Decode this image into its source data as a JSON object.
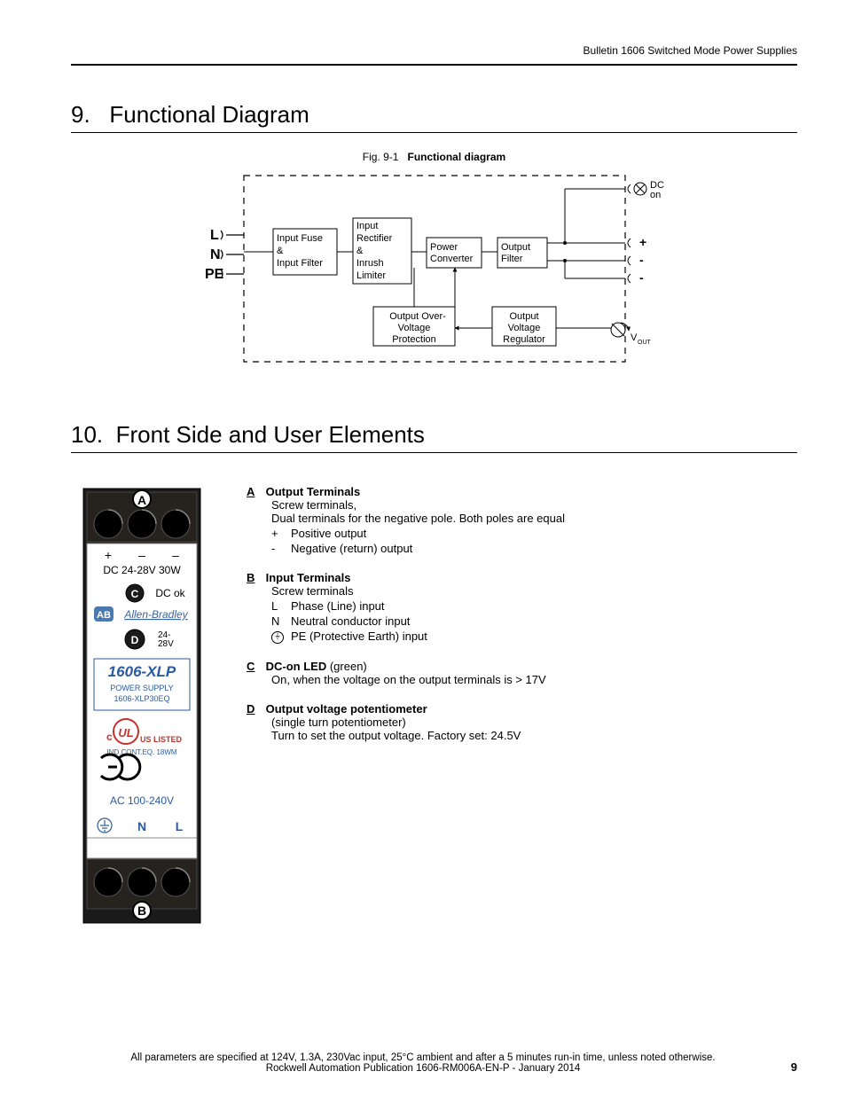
{
  "header": "Bulletin 1606 Switched Mode Power Supplies",
  "section9": {
    "num": "9.",
    "title": "Functional Diagram"
  },
  "figcap": {
    "pre": "Fig. 9-1",
    "title": "Functional diagram"
  },
  "diagram": {
    "inputs": {
      "L": "L",
      "N": "N",
      "PE": "PE"
    },
    "box1a": "Input Fuse",
    "box1b": "&",
    "box1c": "Input Filter",
    "box2a": "Input",
    "box2b": "Rectifier",
    "box2c": "&",
    "box2d": "Inrush",
    "box2e": "Limiter",
    "box3a": "Power",
    "box3b": "Converter",
    "box4a": "Output",
    "box4b": "Filter",
    "box5a": "Output Over-",
    "box5b": "Voltage",
    "box5c": "Protection",
    "box6a": "Output",
    "box6b": "Voltage",
    "box6c": "Regulator",
    "dc_on_a": "DC",
    "dc_on_b": "on",
    "plus": "+",
    "minus1": "-",
    "minus2": "-",
    "vout": "V",
    "vout_sub": "OUT"
  },
  "section10": {
    "num": "10.",
    "title": "Front Side and User Elements"
  },
  "device": {
    "callA": "A",
    "callB": "B",
    "callC": "C",
    "callD": "D",
    "plus": "+",
    "minus1": "–",
    "minus2": "–",
    "dc_line": "DC 24-28V  30W",
    "dc_ok": "DC ok",
    "ab": "AB",
    "brand": "Allen-Bradley",
    "vrange": "24-\n28V",
    "model": "1606-XLP",
    "sub1": "POWER SUPPLY",
    "sub2": "1606-XLP30EQ",
    "ul_c": "c",
    "ul": "UL",
    "ul_listed": "US LISTED",
    "ul_line": "IND.CONT.EQ. 18WM",
    "ce": "CE_GLYPH",
    "ac": "AC 100-240V",
    "inN": "N",
    "inL": "L"
  },
  "desc": {
    "A": {
      "key": "A",
      "title": "Output Terminals",
      "l1": "Screw terminals,",
      "l2": "Dual terminals for the negative pole. Both poles are equal",
      "r1s": "+",
      "r1": "Positive output",
      "r2s": "-",
      "r2": "Negative (return) output"
    },
    "B": {
      "key": "B",
      "title": "Input Terminals",
      "l1": "Screw terminals",
      "r1s": "L",
      "r1": "Phase (Line) input",
      "r2s": "N",
      "r2": "Neutral conductor input",
      "r3": "PE (Protective Earth) input"
    },
    "C": {
      "key": "C",
      "title": "DC-on LED",
      "title_suffix": " (green)",
      "l1": "On, when the voltage on the output terminals is > 17V"
    },
    "D": {
      "key": "D",
      "title": "Output voltage potentiometer",
      "l1": "(single turn potentiometer)",
      "l2": "Turn to set the output voltage. Factory set: 24.5V"
    }
  },
  "footer": {
    "l1": "All parameters are specified at 124V, 1.3A, 230Vac input, 25°C ambient and after a 5 minutes run-in time, unless noted otherwise.",
    "l2": "Rockwell Automation Publication 1606-RM006A-EN-P - January 2014"
  },
  "pagenum": "9"
}
